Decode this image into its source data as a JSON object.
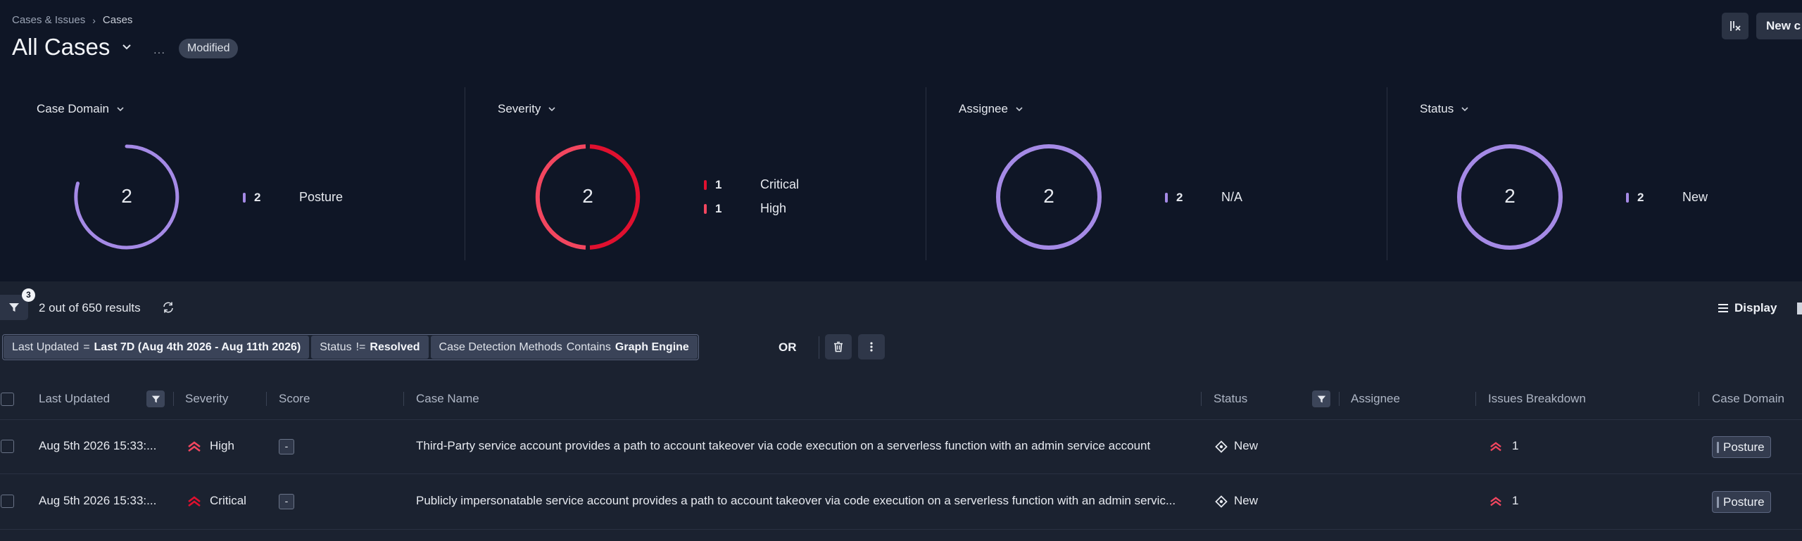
{
  "breadcrumb": {
    "parent": "Cases & Issues",
    "current": "Cases"
  },
  "page": {
    "title": "All Cases",
    "more": "···",
    "badge": "Modified"
  },
  "top_actions": {
    "new_button": "New c"
  },
  "widgets": [
    {
      "title": "Case Domain",
      "total": "2",
      "legend": [
        {
          "count": "2",
          "label": "Posture",
          "color": "#a58ae6"
        }
      ]
    },
    {
      "title": "Severity",
      "total": "2",
      "legend": [
        {
          "count": "1",
          "label": "Critical",
          "color": "#e0102f"
        },
        {
          "count": "1",
          "label": "High",
          "color": "#f2465f"
        }
      ]
    },
    {
      "title": "Assignee",
      "total": "2",
      "legend": [
        {
          "count": "2",
          "label": "N/A",
          "color": "#a58ae6"
        }
      ]
    },
    {
      "title": "Status",
      "total": "2",
      "legend": [
        {
          "count": "2",
          "label": "New",
          "color": "#a58ae6"
        }
      ]
    }
  ],
  "results": {
    "filter_count": "3",
    "summary": "2 out of 650 results",
    "display_label": "Display"
  },
  "filters": [
    {
      "field": "Last Updated",
      "op": "=",
      "value": "Last 7D (Aug 4th 2026 - Aug 11th 2026)"
    },
    {
      "field": "Status",
      "op": "!=",
      "value": "Resolved"
    },
    {
      "field": "Case Detection Methods",
      "op": "Contains",
      "value": "Graph Engine"
    }
  ],
  "or_label": "OR",
  "table": {
    "columns": [
      "Last Updated",
      "Severity",
      "Score",
      "Case Name",
      "Status",
      "Assignee",
      "Issues Breakdown",
      "Case Domain"
    ],
    "rows": [
      {
        "last_updated": "Aug 5th 2026 15:33:...",
        "severity": "High",
        "score": "-",
        "case_name": "Third-Party service account provides a path to account takeover via code execution on a serverless function with an admin service account",
        "status": "New",
        "assignee": "",
        "issues": "1",
        "domain": "Posture"
      },
      {
        "last_updated": "Aug 5th 2026 15:33:...",
        "severity": "Critical",
        "score": "-",
        "case_name": "Publicly impersonatable service account provides a path to account takeover via code execution on a serverless function with an admin servic...",
        "status": "New",
        "assignee": "",
        "issues": "1",
        "domain": "Posture"
      }
    ]
  },
  "colors": {
    "purple": "#a58ae6",
    "critical": "#e0102f",
    "high": "#f2465f",
    "background": "#0f1626",
    "table_bg": "#1b2230"
  }
}
